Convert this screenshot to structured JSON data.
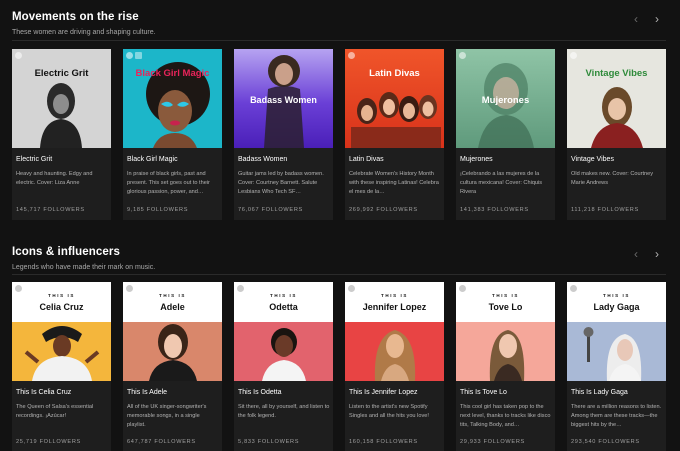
{
  "sections": [
    {
      "title": "Movements on the rise",
      "subtitle": "These women are driving and shaping culture.",
      "cards": [
        {
          "cover_text": "Electric Grit",
          "name": "Electric Grit",
          "desc": "Heavy and haunting. Edgy and electric. Cover: Liza Anne",
          "followers": "145,717 FOLLOWERS",
          "cover_color": "#cfcfcf",
          "text_color": "#111111"
        },
        {
          "cover_text": "Black Girl Magic",
          "name": "Black Girl Magic",
          "desc": "In praise of black girls, past and present. This set goes out to their glorious passion, power, and…",
          "followers": "9,185 FOLLOWERS",
          "cover_color": "#19b4c8",
          "text_color": "#e2245a"
        },
        {
          "cover_text": "Badass Women",
          "name": "Badass Women",
          "desc": "Guitar jams led by badass women. Cover: Courtney Barnett. Salute Lesbians Who Tech SF…",
          "followers": "76,067 FOLLOWERS",
          "cover_color": "#5b34c9",
          "text_color": "#ffffff"
        },
        {
          "cover_text": "Latin Divas",
          "name": "Latin Divas",
          "desc": "Celebrate Women's History Month with these inspiring Latinas! Celebra el mes de la…",
          "followers": "269,992 FOLLOWERS",
          "cover_color": "#e8401f",
          "text_color": "#ffffff"
        },
        {
          "cover_text": "Mujerones",
          "name": "Mujerones",
          "desc": "¡Celebrando a las mujeres de la cultura mexicana! Cover: Chiquis Rivera",
          "followers": "141,383 FOLLOWERS",
          "cover_color": "#6fa88c",
          "text_color": "#ffffff"
        },
        {
          "cover_text": "Vintage Vibes",
          "name": "Vintage Vibes",
          "desc": "Old makes new. Cover: Courtney Marie Andrews",
          "followers": "111,218 FOLLOWERS",
          "cover_color": "#e6e6df",
          "text_color": "#2e8a3a"
        }
      ]
    },
    {
      "title": "Icons & influencers",
      "subtitle": "Legends who have made their mark on music.",
      "cards": [
        {
          "label": "THIS IS",
          "artist": "Celia Cruz",
          "name": "This Is Celia Cruz",
          "desc": "The Queen of Salsa's essential recordings. ¡Azúcar!",
          "followers": "25,719 FOLLOWERS",
          "photo_color": "#f4b63c"
        },
        {
          "label": "THIS IS",
          "artist": "Adele",
          "name": "This Is Adele",
          "desc": "All of the UK singer-songwriter's memorable songs, in a single playlist.",
          "followers": "647,787 FOLLOWERS",
          "photo_color": "#d9876b"
        },
        {
          "label": "THIS IS",
          "artist": "Odetta",
          "name": "This Is Odetta",
          "desc": "Sit there, all by yourself, and listen to the folk legend.",
          "followers": "5,833 FOLLOWERS",
          "photo_color": "#e2636d"
        },
        {
          "label": "THIS IS",
          "artist": "Jennifer Lopez",
          "name": "This Is Jennifer Lopez",
          "desc": "Listen to the artist's new Spotify Singles and all the hits you love!",
          "followers": "160,158 FOLLOWERS",
          "photo_color": "#e84444"
        },
        {
          "label": "THIS IS",
          "artist": "Tove Lo",
          "name": "This Is Tove Lo",
          "desc": "This cool girl has taken pop to the next level, thanks to tracks like disco tits, Talking Body, and…",
          "followers": "29,933 FOLLOWERS",
          "photo_color": "#f5a79a"
        },
        {
          "label": "THIS IS",
          "artist": "Lady Gaga",
          "name": "This Is Lady Gaga",
          "desc": "There are a million reasons to listen. Among them are these tracks—the biggest hits by the…",
          "followers": "293,540 FOLLOWERS",
          "photo_color": "#a9b9d6"
        }
      ]
    }
  ],
  "nav": {
    "prev": "‹",
    "next": "›"
  }
}
